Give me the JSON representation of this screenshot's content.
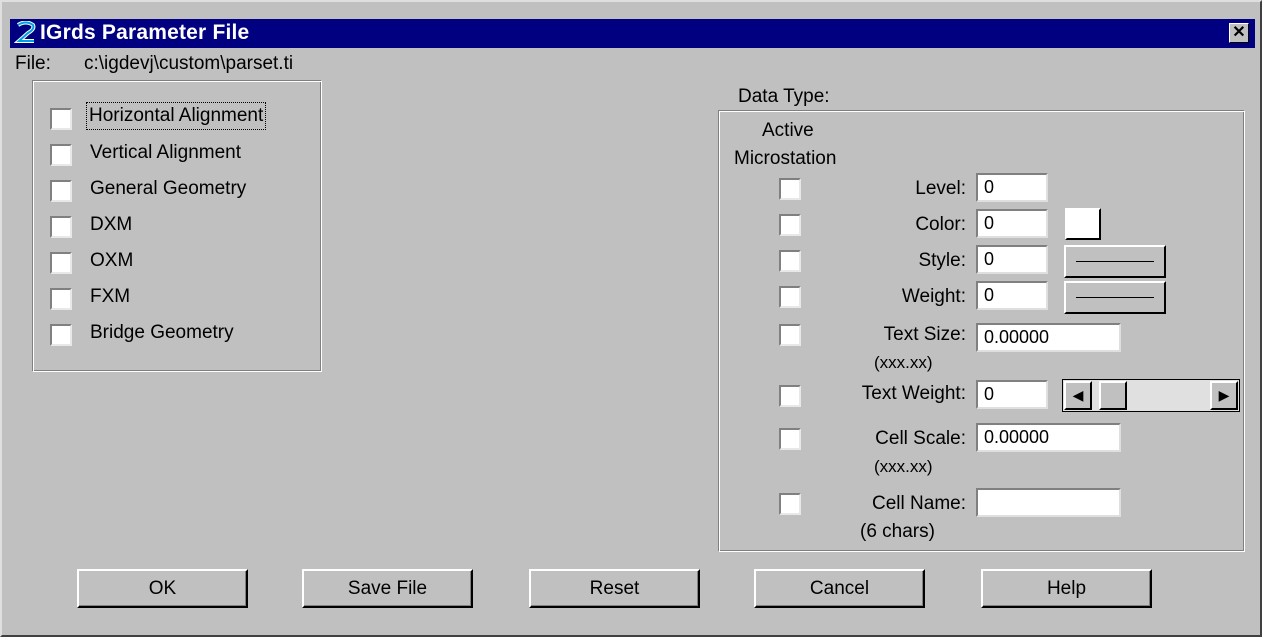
{
  "window": {
    "title": "IGrds Parameter File",
    "close_glyph": "✕",
    "title_bar_color": "#000080",
    "background_color": "#c0c0c0"
  },
  "file": {
    "label": "File:",
    "path": "c:\\igdevj\\custom\\parset.ti"
  },
  "types": [
    {
      "label": "Horizontal Alignment",
      "checked": false,
      "focused": true
    },
    {
      "label": "Vertical Alignment",
      "checked": false
    },
    {
      "label": "General Geometry",
      "checked": false
    },
    {
      "label": "DXM",
      "checked": false
    },
    {
      "label": "OXM",
      "checked": false
    },
    {
      "label": "FXM",
      "checked": false
    },
    {
      "label": "Bridge Geometry",
      "checked": false
    }
  ],
  "data_type": {
    "heading": "Data Type:",
    "active_label": "Active",
    "microstation_label": "Microstation",
    "level": {
      "label": "Level:",
      "value": "0"
    },
    "color": {
      "label": "Color:",
      "value": "0"
    },
    "style": {
      "label": "Style:",
      "value": "0"
    },
    "weight": {
      "label": "Weight:",
      "value": "0"
    },
    "text_size": {
      "label": "Text Size:",
      "hint": "(xxx.xx)",
      "value": "0.00000"
    },
    "text_weight": {
      "label": "Text Weight:",
      "value": "0"
    },
    "cell_scale": {
      "label": "Cell Scale:",
      "hint": "(xxx.xx)",
      "value": "0.00000"
    },
    "cell_name": {
      "label": "Cell Name:",
      "hint": "(6 chars)",
      "value": ""
    }
  },
  "buttons": {
    "ok": "OK",
    "save": "Save File",
    "reset": "Reset",
    "cancel": "Cancel",
    "help": "Help"
  },
  "scrollbar": {
    "left_arrow": "◀",
    "right_arrow": "▶"
  },
  "icons": {
    "app": "igrds-app-icon",
    "close": "close-icon"
  }
}
